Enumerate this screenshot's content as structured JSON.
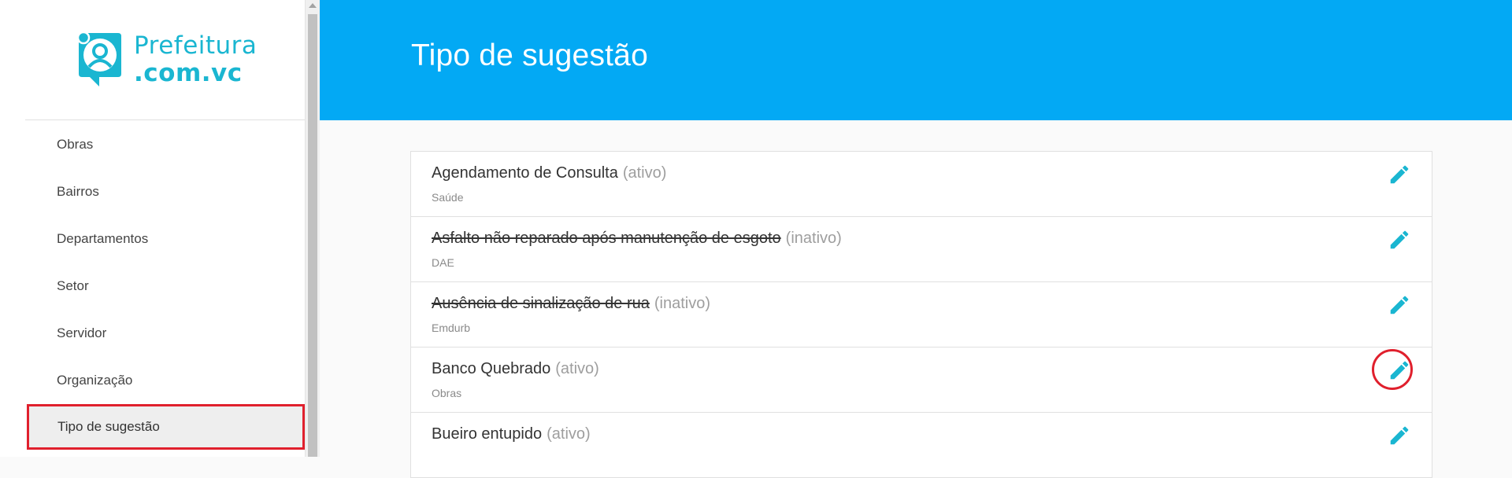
{
  "app": {
    "logo_line1": "Prefeitura",
    "logo_line2": ".com.vc",
    "brand_color": "#1ab6d1"
  },
  "sidebar": {
    "items": [
      {
        "label": "Obras"
      },
      {
        "label": "Bairros"
      },
      {
        "label": "Departamentos"
      },
      {
        "label": "Setor"
      },
      {
        "label": "Servidor"
      },
      {
        "label": "Organização"
      },
      {
        "label": "Tipo de sugestão",
        "active": true
      }
    ]
  },
  "header": {
    "title": "Tipo de sugestão",
    "color": "#03a9f4"
  },
  "list": {
    "rows": [
      {
        "name": "Agendamento de Consulta",
        "status": "(ativo)",
        "department": "Saúde",
        "inactive": false,
        "edit_icon": "pencil-icon"
      },
      {
        "name": "Asfalto não reparado após manutenção de esgoto",
        "status": "(inativo)",
        "department": "DAE",
        "inactive": true,
        "edit_icon": "pencil-icon"
      },
      {
        "name": "Ausência de sinalização de rua",
        "status": "(inativo)",
        "department": "Emdurb",
        "inactive": true,
        "edit_icon": "pencil-icon"
      },
      {
        "name": "Banco Quebrado",
        "status": "(ativo)",
        "department": "Obras",
        "inactive": false,
        "edit_icon": "pencil-icon"
      },
      {
        "name": "Bueiro entupido",
        "status": "(ativo)",
        "department": "",
        "inactive": false,
        "edit_icon": "pencil-icon"
      }
    ]
  },
  "colors": {
    "accent": "#1ab6d1",
    "highlight": "#e0202d"
  }
}
